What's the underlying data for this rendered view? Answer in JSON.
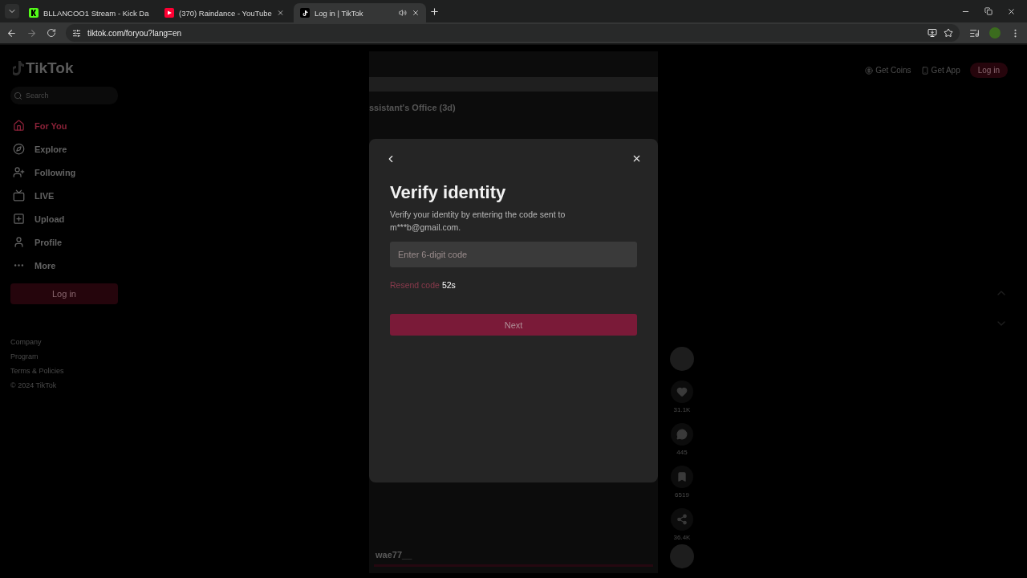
{
  "browser": {
    "tabs": [
      {
        "title": "BLLANCOO1 Stream - Kick Da",
        "kind": "kick",
        "selected": false,
        "audio": false
      },
      {
        "title": "(370) Raindance - YouTube",
        "kind": "youtube",
        "selected": false,
        "audio": false
      },
      {
        "title": "Log in | TikTok",
        "kind": "tiktok",
        "selected": true,
        "audio": true
      }
    ],
    "url": "tiktok.com/foryou?lang=en"
  },
  "sidebar": {
    "logo": "TikTok",
    "search": {
      "placeholder": "Search"
    },
    "items": [
      {
        "label": "For You",
        "kind": "home",
        "selected": true
      },
      {
        "label": "Explore",
        "kind": "compass",
        "selected": false
      },
      {
        "label": "Following",
        "kind": "users",
        "selected": false
      },
      {
        "label": "LIVE",
        "kind": "live",
        "selected": false
      },
      {
        "label": "Upload",
        "kind": "upload",
        "selected": false
      },
      {
        "label": "Profile",
        "kind": "user",
        "selected": false
      },
      {
        "label": "More",
        "kind": "more",
        "selected": false
      }
    ],
    "login_button": "Log in",
    "footer": [
      "Company",
      "Program",
      "Terms & Policies",
      "© 2024 TikTok"
    ]
  },
  "header": {
    "get_coins": "Get Coins",
    "get_app": "Get App",
    "login_button": "Log in"
  },
  "video": {
    "title": "ssistant's Office (3d)",
    "username": "wae77__",
    "actions": [
      {
        "kind": "like",
        "count": "31.1K"
      },
      {
        "kind": "comment",
        "count": "445"
      },
      {
        "kind": "bookmark",
        "count": "6519"
      },
      {
        "kind": "share",
        "count": "36.4K"
      }
    ]
  },
  "modal": {
    "title": "Verify identity",
    "description": "Verify your identity by entering the code sent to m***b@gmail.com.",
    "code_field": {
      "placeholder": "Enter 6-digit code"
    },
    "resend": {
      "label": "Resend code",
      "countdown": "52s"
    },
    "next_button": {
      "label": "Next",
      "disabled": true
    }
  }
}
